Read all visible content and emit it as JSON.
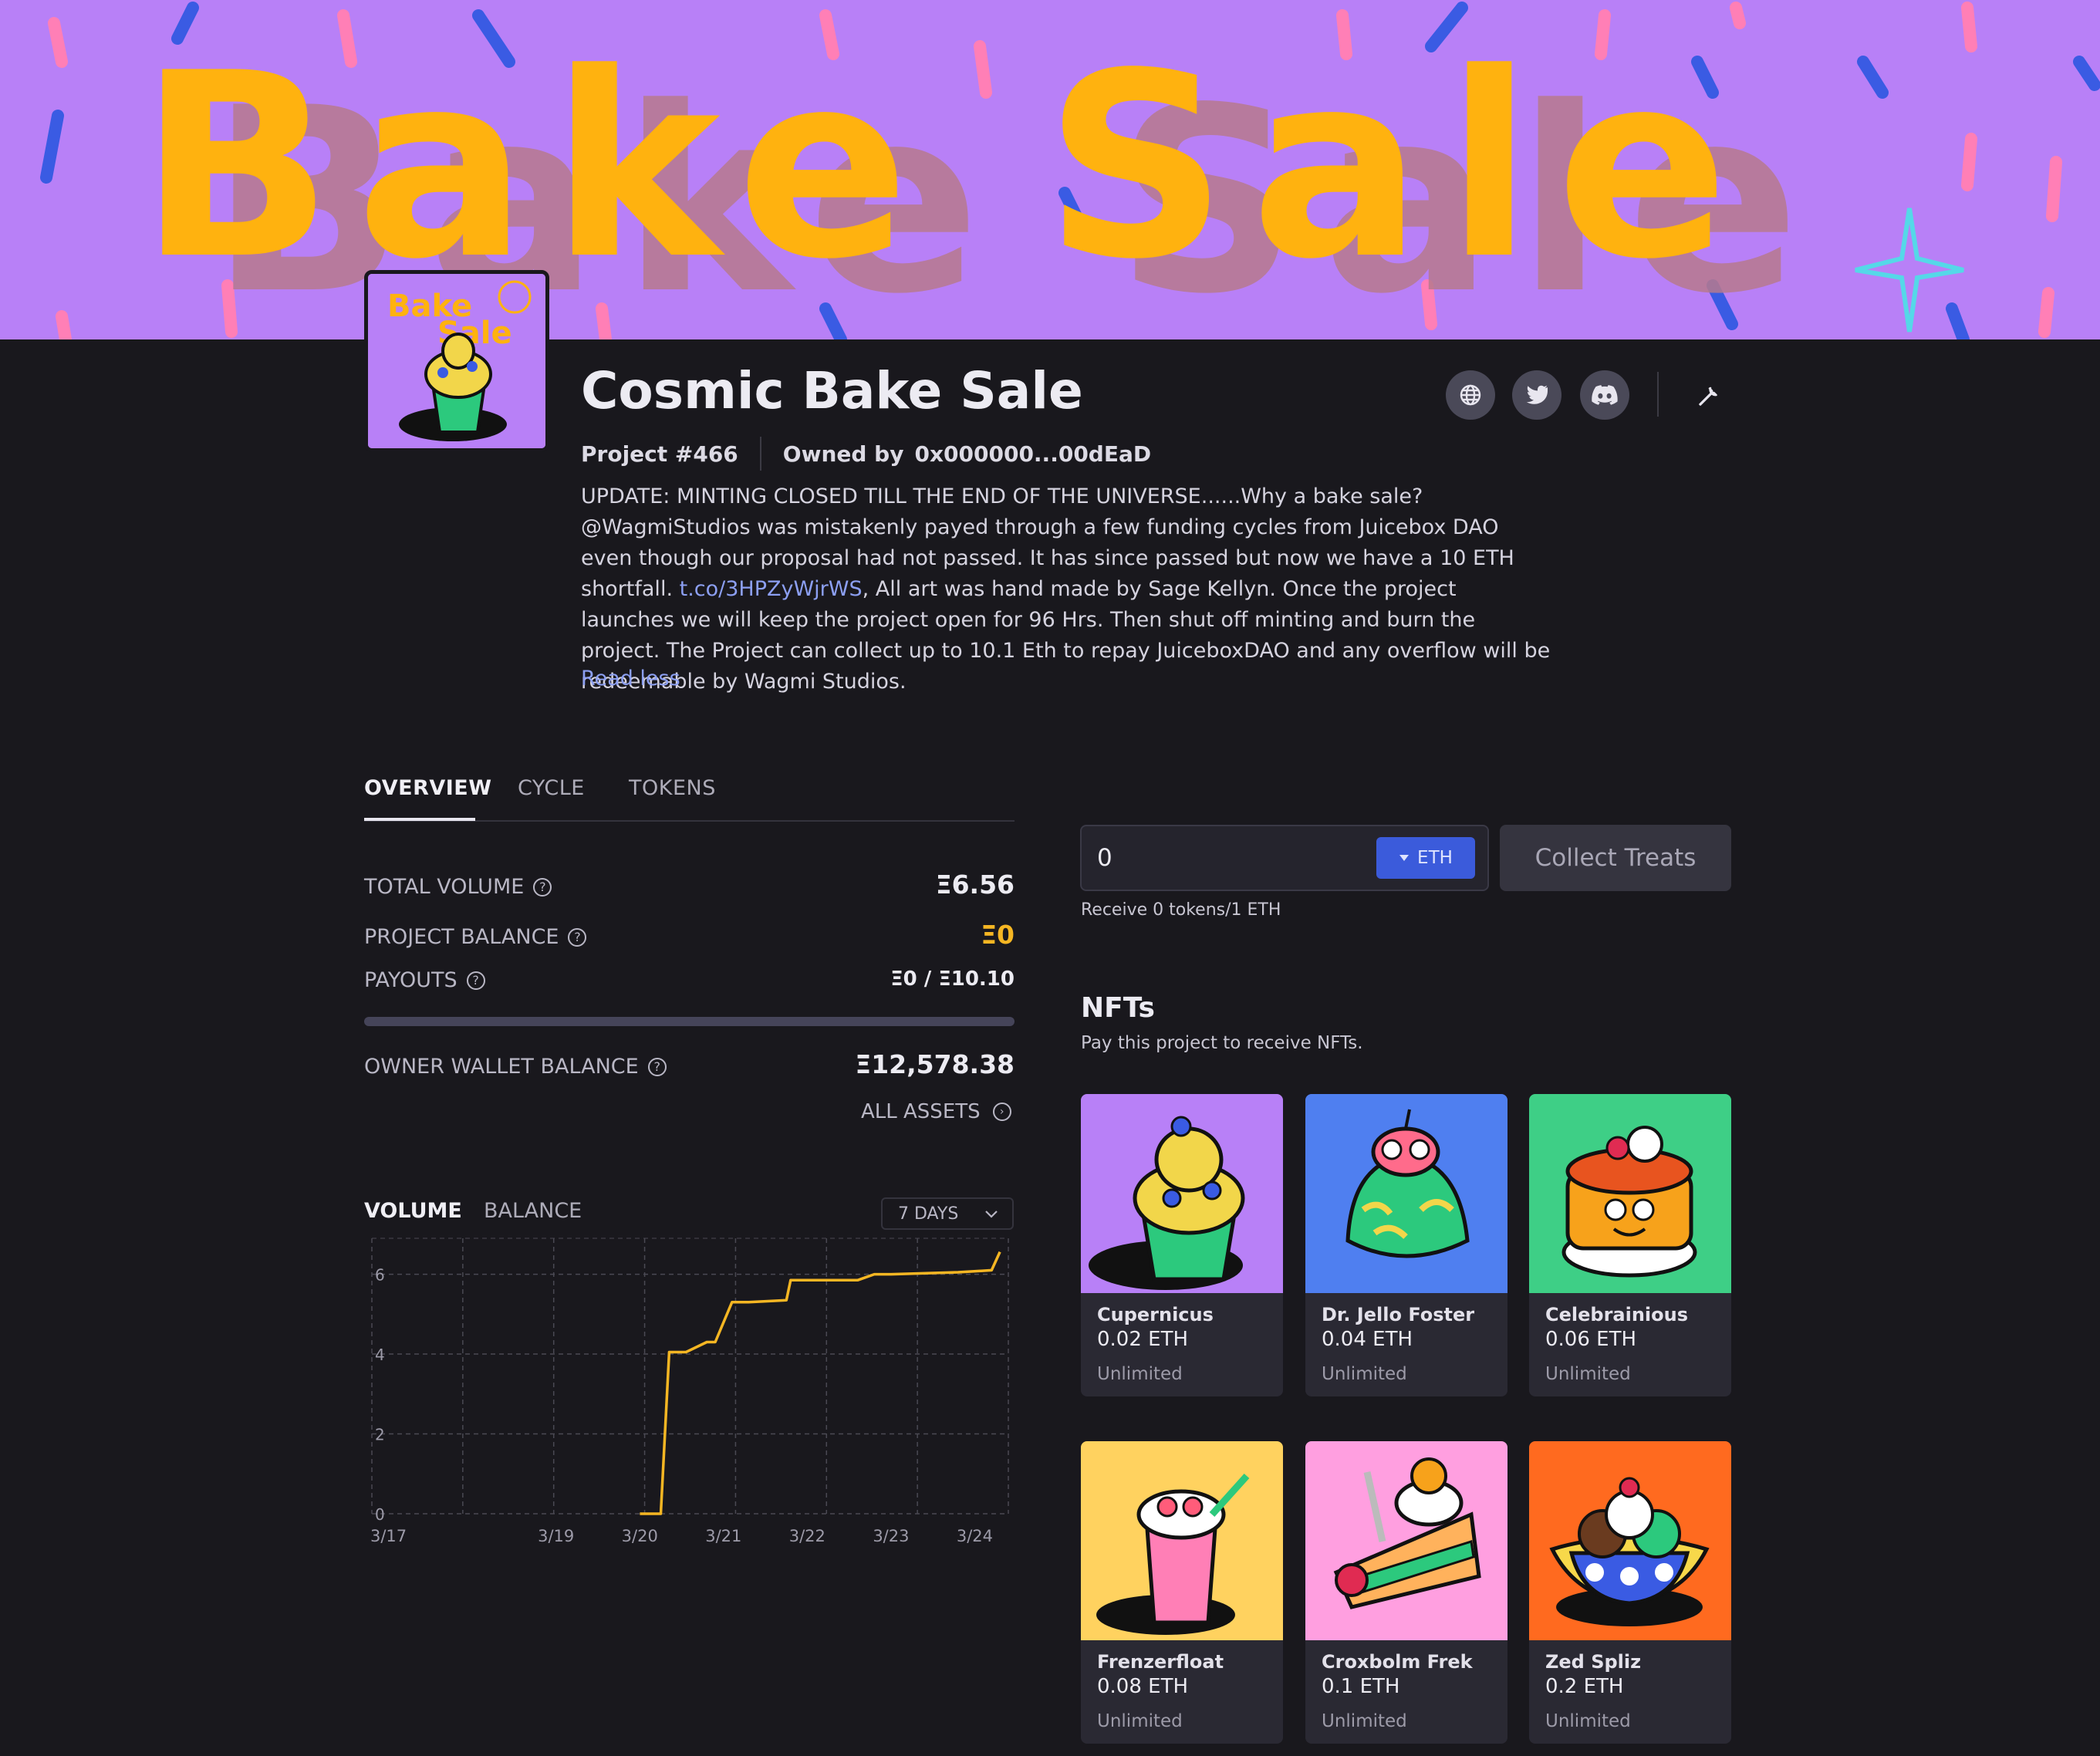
{
  "banner": {
    "headline": "Bake Sale"
  },
  "logo": {
    "text_line1": "Bake",
    "text_line2": "Sale"
  },
  "project": {
    "name": "Cosmic Bake Sale",
    "number": "Project #466",
    "owned_by_label": "Owned by",
    "owner_address": "0x000000...00dEaD",
    "description_part1": "UPDATE: MINTING CLOSED TILL THE END OF THE UNIVERSE......Why a bake sale? @WagmiStudios was mistakenly payed through a few funding cycles from Juicebox DAO even though our proposal had not passed. It has since passed but now we have a 10 ETH shortfall. ",
    "description_link": "t.co/3HPZyWjrWS",
    "description_part2": ", All art was hand made by Sage Kellyn. Once the project launches we will keep the project open for 96 Hrs. Then shut off minting and burn the project. The Project can collect up to 10.1 Eth to repay JuiceboxDAO and any overflow will be redeemable by Wagmi Studios.",
    "read_less": "Read less"
  },
  "social_icons": [
    "globe-icon",
    "twitter-icon",
    "discord-icon"
  ],
  "tabs": [
    {
      "label": "OVERVIEW",
      "active": true
    },
    {
      "label": "CYCLE",
      "active": false
    },
    {
      "label": "TOKENS",
      "active": false
    }
  ],
  "stats": {
    "total_volume": {
      "label": "TOTAL VOLUME",
      "value": "Ξ6.56"
    },
    "project_balance": {
      "label": "PROJECT BALANCE",
      "value": "Ξ0",
      "color": "#f5b623"
    },
    "payouts": {
      "label": "PAYOUTS",
      "value": "Ξ0 / Ξ10.10",
      "progress": 0
    },
    "owner_wallet_balance": {
      "label": "OWNER WALLET BALANCE",
      "value": "Ξ12,578.38"
    },
    "all_assets": "ALL ASSETS"
  },
  "chart_tabs": {
    "volume": "VOLUME",
    "balance": "BALANCE",
    "range": "7 DAYS"
  },
  "chart_data": {
    "type": "line",
    "x": [
      "3/17",
      "3/18",
      "3/19",
      "3/20",
      "3/20.3",
      "3/20.45",
      "3/20.55",
      "3/20.75",
      "3/21",
      "3/21.1",
      "3/21.3",
      "3/21.5",
      "3/21.95",
      "3/22",
      "3/22.2",
      "3/22.8",
      "3/23",
      "3/23.2",
      "3/24",
      "3/24.4",
      "3/24.5"
    ],
    "series": [
      {
        "values": [
          0,
          0,
          0,
          0,
          0,
          0,
          4.05,
          4.05,
          4.3,
          4.3,
          5.3,
          5.3,
          5.35,
          5.85,
          5.85,
          5.85,
          6.0,
          6.0,
          6.05,
          6.1,
          6.56
        ],
        "color": "#f5b623"
      }
    ],
    "tick_labels_x": [
      "3/17",
      "3/19",
      "3/20",
      "3/21",
      "3/22",
      "3/23",
      "3/24"
    ],
    "tick_labels_y": [
      "0",
      "2",
      "4",
      "6"
    ],
    "ylim": [
      0,
      6.9
    ],
    "grid": true
  },
  "pay": {
    "amount": "0",
    "currency": "ETH",
    "button": "Collect Treats",
    "receive_note": "Receive 0 tokens/1 ETH"
  },
  "nfts": {
    "title": "NFTs",
    "subtitle": "Pay this project to receive NFTs.",
    "items": [
      {
        "name": "Cupernicus",
        "price": "0.02 ETH",
        "supply": "Unlimited",
        "bg": "#b880f7"
      },
      {
        "name": "Dr. Jello Foster",
        "price": "0.04 ETH",
        "supply": "Unlimited",
        "bg": "#4f7ff0"
      },
      {
        "name": "Celebrainious",
        "price": "0.06 ETH",
        "supply": "Unlimited",
        "bg": "#3ecf86"
      },
      {
        "name": "Frenzerfloat",
        "price": "0.08 ETH",
        "supply": "Unlimited",
        "bg": "#ffd25f"
      },
      {
        "name": "Croxbolm Frek",
        "price": "0.1 ETH",
        "supply": "Unlimited",
        "bg": "#ff9fe0"
      },
      {
        "name": "Zed Spliz",
        "price": "0.2 ETH",
        "supply": "Unlimited",
        "bg": "#ff6a1f"
      }
    ]
  }
}
